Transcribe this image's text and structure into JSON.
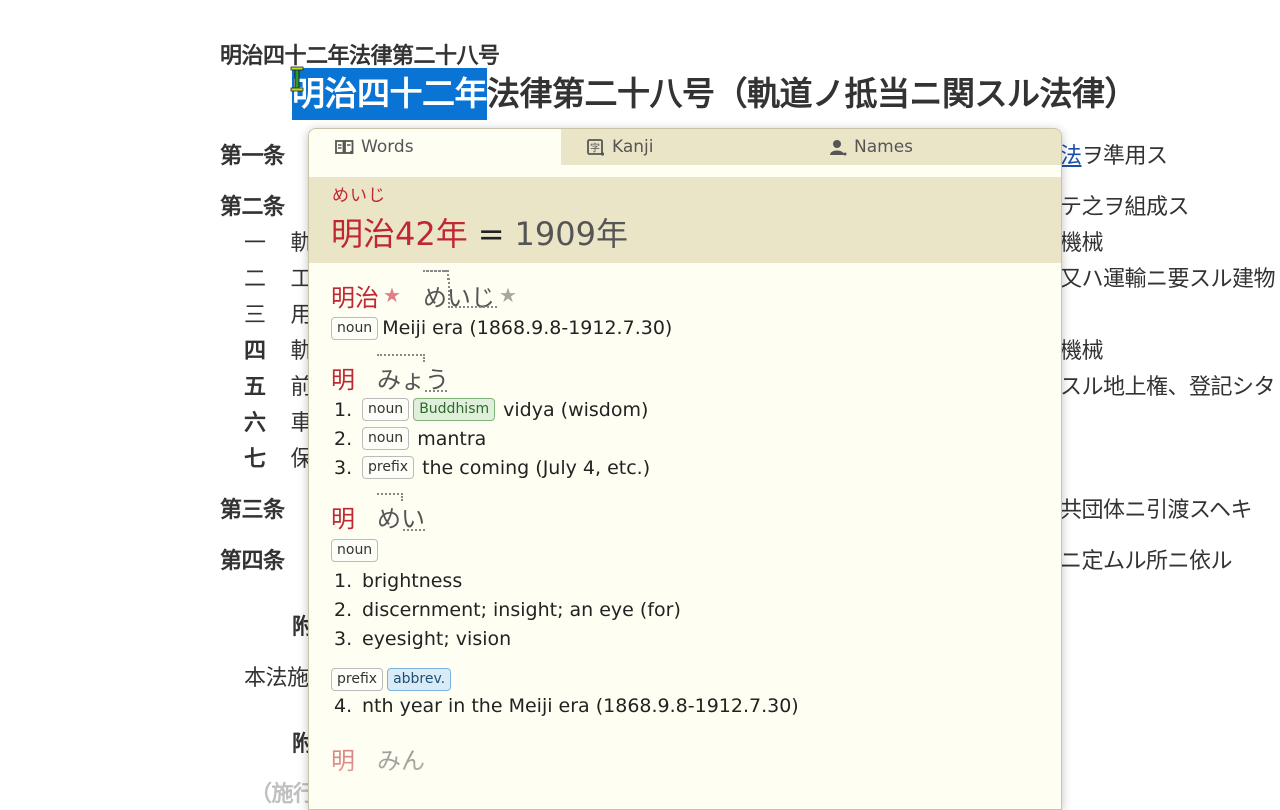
{
  "document": {
    "subtitle": "明治四十二年法律第二十八号",
    "title_selected": "明治四十二年",
    "title_rest": "法律第二十八号（軌道ノ抵当ニ関スル法律）",
    "left_lines": [
      {
        "text": "第一条",
        "bold": true
      },
      {
        "text": "第二条",
        "bold": true
      },
      {
        "text": "一",
        "bold": false,
        "cont": "軌"
      },
      {
        "text": "二",
        "bold": false,
        "cont": "工"
      },
      {
        "text": "三",
        "bold": false,
        "cont": "用"
      },
      {
        "text": "四",
        "bold": true,
        "cont": "軌"
      },
      {
        "text": "五",
        "bold": true,
        "cont": "前"
      },
      {
        "text": "六",
        "bold": true,
        "cont": "車"
      },
      {
        "text": "七",
        "bold": true,
        "cont": "保"
      },
      {
        "text": "第三条",
        "bold": true
      },
      {
        "text": "第四条",
        "bold": true
      },
      {
        "text": "附",
        "bold": true
      },
      {
        "text": "本法施",
        "bold": false
      },
      {
        "text": "附",
        "bold": true
      },
      {
        "text": "（施行",
        "bold": true
      }
    ],
    "right_lines": {
      "r1_link": "法",
      "r1_rest": "ヲ準用ス",
      "r2": "テ之ヲ組成ス",
      "r3": "機械",
      "r4": "又ハ運輸ニ要スル建物",
      "r5": "機械",
      "r6": "スル地上権、登記シタ",
      "r7": "共団体ニ引渡スヘキ",
      "r8": "ニ定ムル所ニ依ル"
    }
  },
  "popup": {
    "tabs": [
      {
        "label": "Words",
        "icon": "book-icon",
        "active": true
      },
      {
        "label": "Kanji",
        "icon": "kanji-icon",
        "active": false
      },
      {
        "label": "Names",
        "icon": "person-icon",
        "active": false
      }
    ],
    "meta": {
      "reading": "めいじ",
      "era": "明治42年",
      "equals": "=",
      "gregorian": "1909年"
    },
    "entries": [
      {
        "word": "明治",
        "reading": "めいじ",
        "starred": true,
        "senses": [
          {
            "tags": [
              "noun"
            ],
            "gloss": "Meiji era (1868.9.8-1912.7.30)"
          }
        ]
      },
      {
        "word": "明",
        "reading": "みょう",
        "senses": [
          {
            "num": "1.",
            "tags": [
              "noun"
            ],
            "field": "Buddhism",
            "gloss": "vidya (wisdom)"
          },
          {
            "num": "2.",
            "tags": [
              "noun"
            ],
            "gloss": "mantra"
          },
          {
            "num": "3.",
            "tags": [
              "prefix"
            ],
            "gloss": "the coming (July 4, etc.)"
          }
        ]
      },
      {
        "word": "明",
        "reading": "めい",
        "group1_tag": "noun",
        "senses": [
          {
            "num": "1.",
            "gloss": "brightness"
          },
          {
            "num": "2.",
            "gloss": "discernment; insight; an eye (for)"
          },
          {
            "num": "3.",
            "gloss": "eyesight; vision"
          }
        ],
        "group2_tags": [
          "prefix",
          "abbrev."
        ],
        "sense4": {
          "num": "4.",
          "gloss": "nth year in the Meiji era (1868.9.8-1912.7.30)"
        }
      },
      {
        "word": "明",
        "reading": "みん"
      }
    ]
  },
  "colors": {
    "selection": "#0a74d4",
    "kanji_red": "#c02732",
    "popup_bg": "#fefef2",
    "band_bg": "#ebe5c8"
  }
}
